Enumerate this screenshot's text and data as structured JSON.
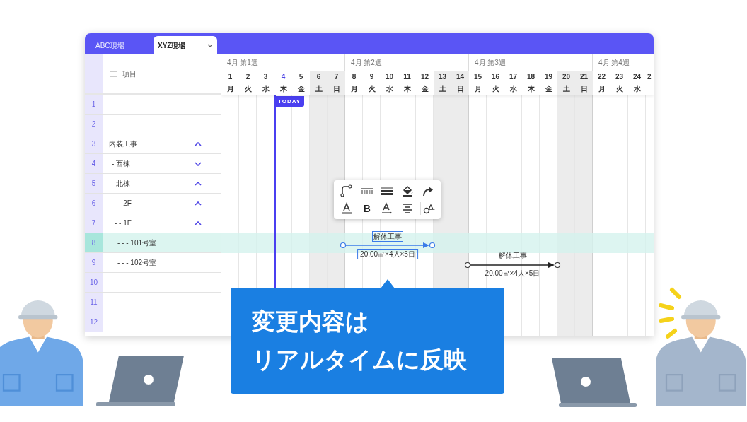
{
  "tabs": [
    {
      "label": "ABC現場",
      "selected": false
    },
    {
      "label": "XYZ現場",
      "selected": true
    }
  ],
  "item_header": "項目",
  "rows": [
    {
      "number": "1",
      "selected": false
    },
    {
      "number": "2",
      "selected": false
    },
    {
      "number": "3",
      "label": "内装工事",
      "expanded": true,
      "selected": false,
      "children": [
        {
          "number": "4",
          "label": "- 西棟",
          "expanded": false,
          "selected": false
        },
        {
          "number": "5",
          "label": "- 北棟",
          "expanded": true,
          "selected": false,
          "children": [
            {
              "number": "6",
              "label": "- - 2F",
              "expanded": true,
              "selected": false
            },
            {
              "number": "7",
              "label": "- - 1F",
              "expanded": true,
              "selected": false,
              "children": [
                {
                  "number": "8",
                  "label": "- - - 101号室",
                  "selected": true
                },
                {
                  "number": "9",
                  "label": "- - - 102号室",
                  "selected": false
                }
              ]
            }
          ]
        }
      ]
    },
    {
      "number": "10",
      "selected": false
    },
    {
      "number": "11",
      "selected": false
    },
    {
      "number": "12",
      "selected": false
    }
  ],
  "weeks": [
    {
      "label": "4月 第1週"
    },
    {
      "label": "4月 第2週"
    },
    {
      "label": "4月 第3週"
    },
    {
      "label": "4月 第4週"
    }
  ],
  "days": [
    {
      "date": "1",
      "weekday": "月",
      "weekend": false,
      "today": false
    },
    {
      "date": "2",
      "weekday": "火",
      "weekend": false,
      "today": false
    },
    {
      "date": "3",
      "weekday": "水",
      "weekend": false,
      "today": false
    },
    {
      "date": "4",
      "weekday": "木",
      "weekend": false,
      "today": true
    },
    {
      "date": "5",
      "weekday": "金",
      "weekend": false,
      "today": false
    },
    {
      "date": "6",
      "weekday": "土",
      "weekend": true,
      "today": false
    },
    {
      "date": "7",
      "weekday": "日",
      "weekend": true,
      "today": false
    },
    {
      "date": "8",
      "weekday": "月",
      "weekend": false,
      "today": false
    },
    {
      "date": "9",
      "weekday": "火",
      "weekend": false,
      "today": false
    },
    {
      "date": "10",
      "weekday": "水",
      "weekend": false,
      "today": false
    },
    {
      "date": "11",
      "weekday": "木",
      "weekend": false,
      "today": false
    },
    {
      "date": "12",
      "weekday": "金",
      "weekend": false,
      "today": false
    },
    {
      "date": "13",
      "weekday": "土",
      "weekend": true,
      "today": false
    },
    {
      "date": "14",
      "weekday": "日",
      "weekend": true,
      "today": false
    },
    {
      "date": "15",
      "weekday": "月",
      "weekend": false,
      "today": false
    },
    {
      "date": "16",
      "weekday": "火",
      "weekend": false,
      "today": false
    },
    {
      "date": "17",
      "weekday": "水",
      "weekend": false,
      "today": false
    },
    {
      "date": "18",
      "weekday": "木",
      "weekend": false,
      "today": false
    },
    {
      "date": "19",
      "weekday": "金",
      "weekend": false,
      "today": false
    },
    {
      "date": "20",
      "weekday": "土",
      "weekend": true,
      "today": false
    },
    {
      "date": "21",
      "weekday": "日",
      "weekend": true,
      "today": false
    },
    {
      "date": "22",
      "weekday": "月",
      "weekend": false,
      "today": false
    },
    {
      "date": "23",
      "weekday": "火",
      "weekend": false,
      "today": false
    },
    {
      "date": "24",
      "weekday": "水",
      "weekend": false,
      "today": false
    },
    {
      "date": "2",
      "weekend": false,
      "today": false
    }
  ],
  "today_label": "TODAY",
  "toolbar": [
    {
      "kind": "connector"
    },
    {
      "kind": "dotted-line"
    },
    {
      "kind": "line-weight"
    },
    {
      "kind": "fill"
    },
    {
      "kind": "arrow"
    },
    {
      "kind": "text-color"
    },
    {
      "kind": "bold",
      "text": "B"
    },
    {
      "kind": "text-arrow"
    },
    {
      "kind": "align"
    },
    {
      "kind": "shape"
    }
  ],
  "bars": [
    {
      "label": "解体工事",
      "quantity": "20.00㎡×4人×5日",
      "selected": true
    },
    {
      "label": "解体工事",
      "quantity": "20.00㎡×4人×5日",
      "selected": false
    }
  ],
  "callout": [
    "変更内容は",
    "リアルタイムに反映"
  ]
}
